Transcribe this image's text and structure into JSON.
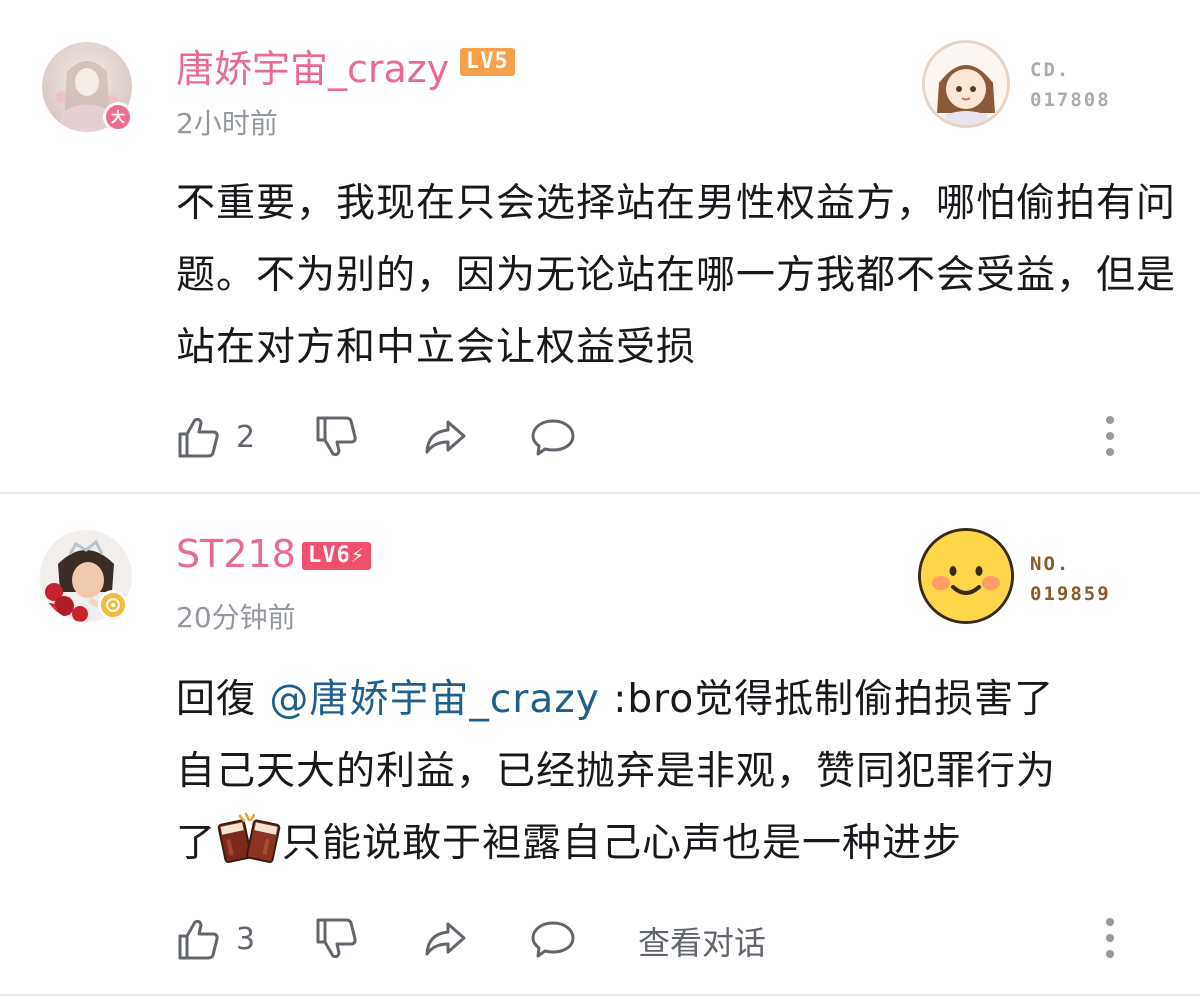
{
  "comments": [
    {
      "username": "唐娇宇宙_crazy",
      "level": "LV5",
      "time": "2小时前",
      "avatar_badge": "大",
      "fan_label_top": "CD.",
      "fan_label_num": "017808",
      "content": "不重要，我现在只会选择站在男性权益方，哪怕偷拍有问题。不为别的，因为无论站在哪一方我都不会受益，但是站在对方和中立会让权益受损",
      "likes": "2"
    },
    {
      "username": "ST218",
      "level": "LV6⚡",
      "time": "20分钟前",
      "fan_label_top": "NO.",
      "fan_label_num": "019859",
      "content_prefix": "回復 ",
      "mention": "@唐娇宇宙_crazy",
      "content_line1_rest": " :bro觉得抵制偷拍损害了",
      "content_line2": "自己天大的利益，已经抛弃是非观，赞同犯罪行为",
      "content_line3_start": "了",
      "content_line3_rest": "只能说敢于袒露自己心声也是一种进步",
      "likes": "3",
      "view_conversation": "查看对话"
    }
  ],
  "colors": {
    "username": "#eb6a94",
    "level_lv5": "#f5a04a",
    "level_lv6": "#f0506e",
    "mention": "#1e5f8c",
    "meta_gray": "#9499a0"
  },
  "icons": [
    "like-icon",
    "dislike-icon",
    "share-icon",
    "reply-icon",
    "more-icon"
  ]
}
